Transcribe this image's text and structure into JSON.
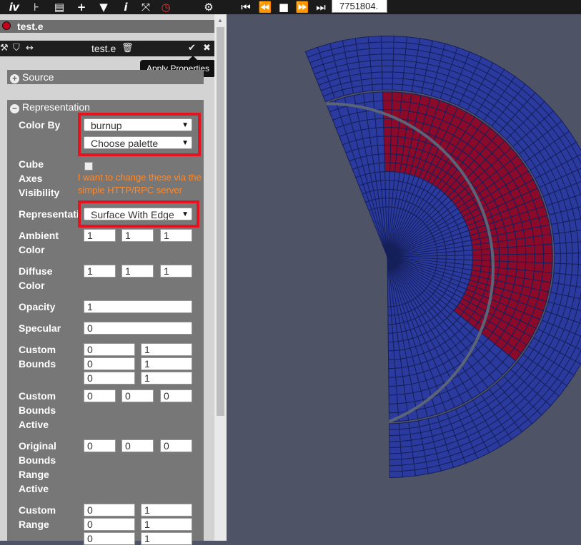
{
  "toolbar": {
    "icons": [
      "logo-icon",
      "pipeline-icon",
      "file-icon",
      "add-icon",
      "filter-icon",
      "info-icon",
      "fullscreen-icon",
      "timer-icon",
      "settings-icon",
      "first-frame-icon",
      "previous-frame-icon",
      "stop-icon",
      "next-frame-icon",
      "last-frame-icon"
    ],
    "time_value": "7751804."
  },
  "file": {
    "name": "test.e",
    "color": "#c4001e"
  },
  "properties_bar": {
    "title": "test.e",
    "apply_tooltip": "Apply Properties"
  },
  "source": {
    "label": "Source"
  },
  "representation": {
    "label": "Representation",
    "color_by_label": "Color By",
    "color_by_value": "burnup",
    "palette_value": "Choose palette",
    "cube_axes_label": [
      "Cube",
      "Axes",
      "Visibility"
    ],
    "representation_label": "Representati",
    "representation_value": "Surface With Edge",
    "ambient_label": [
      "Ambient",
      "Color"
    ],
    "ambient_values": [
      "1",
      "1",
      "1"
    ],
    "diffuse_label": [
      "Diffuse",
      "Color"
    ],
    "diffuse_values": [
      "1",
      "1",
      "1"
    ],
    "opacity_label": "Opacity",
    "opacity_value": "1",
    "specular_label": "Specular",
    "specular_value": "0",
    "custom_bounds_label": [
      "Custom",
      "Bounds"
    ],
    "custom_bounds_values": [
      [
        "0",
        "1"
      ],
      [
        "0",
        "1"
      ],
      [
        "0",
        "1"
      ]
    ],
    "custom_bounds_active_label": [
      "Custom",
      "Bounds",
      "Active"
    ],
    "custom_bounds_active_values": [
      "0",
      "0",
      "0"
    ],
    "original_bounds_label": [
      "Original",
      "Bounds",
      "Range",
      "Active"
    ],
    "original_bounds_values": [
      "0",
      "0",
      "0"
    ],
    "custom_range_label": [
      "Custom",
      "Range"
    ],
    "custom_range_values": [
      [
        "0",
        "1"
      ],
      [
        "0",
        "1"
      ],
      [
        "0",
        "1"
      ]
    ]
  },
  "annotation": {
    "text": "I want to change these via the simple HTTP/RPC server",
    "color": "#ff8a2a"
  },
  "mesh": {
    "burnup_high_color": "#8b0a2a",
    "burnup_low_color": "#2b3a9e"
  }
}
